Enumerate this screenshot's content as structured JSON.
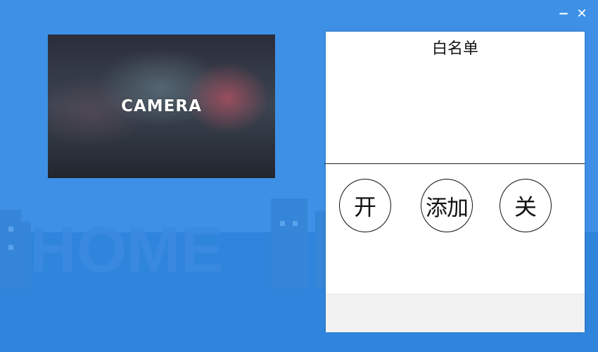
{
  "window": {
    "minimize_icon": "minimize-icon",
    "close_icon": "close-icon",
    "minimize_glyph": "−",
    "close_glyph": "✕"
  },
  "camera": {
    "label": "CAMERA"
  },
  "background": {
    "art_text": "HOME"
  },
  "whitelist": {
    "title": "白名单",
    "buttons": {
      "open_label": "开",
      "add_label": "添加",
      "close_label": "关"
    }
  },
  "colors": {
    "background": "#3d90e6",
    "panel": "#ffffff",
    "text": "#111111"
  }
}
